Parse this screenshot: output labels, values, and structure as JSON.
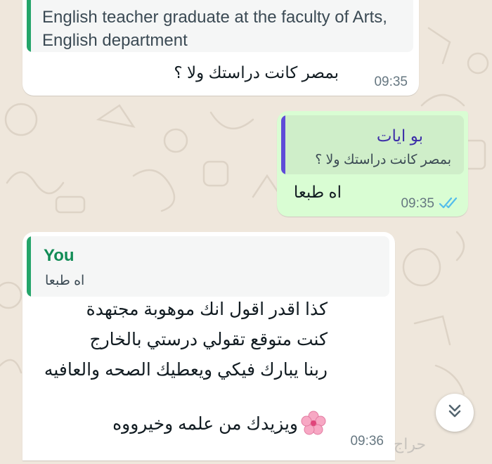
{
  "colors": {
    "wallpaper": "#efe7dc",
    "incoming_bubble": "#ffffff",
    "outgoing_bubble": "#d9fdd3",
    "quote_bar_green": "#25a56a",
    "quote_bar_purple": "#5f4bd8",
    "read_ticks": "#53bdeb"
  },
  "messages": [
    {
      "direction": "incoming",
      "quote": {
        "text": "English teacher graduate at the faculty of Arts, English department"
      },
      "text": "بمصر كانت دراستك ولا ؟",
      "time": "09:35"
    },
    {
      "direction": "outgoing",
      "quote": {
        "sender": "بو ايات",
        "text": "بمصر كانت دراستك ولا ؟"
      },
      "text": "اه طبعا",
      "time": "09:35",
      "status_icon": "double-check-read-icon"
    },
    {
      "direction": "incoming",
      "quote": {
        "sender": "You",
        "text": "اه طبعا"
      },
      "lines": [
        "كذا اقدر اقول انك موهوبة مجتهدة",
        "كنت متوقع تقولي درستي بالخارج",
        "ربنا يبارك فيكي ويعطيك الصحه والعافيه",
        "ويزيدك من علمه وخيرووه"
      ],
      "emoji_icon": "cherry-blossom-icon",
      "time": "09:36"
    }
  ],
  "scroll_button": {
    "icon": "chevron-double-down-icon"
  },
  "watermark": {
    "text": "حراج"
  }
}
